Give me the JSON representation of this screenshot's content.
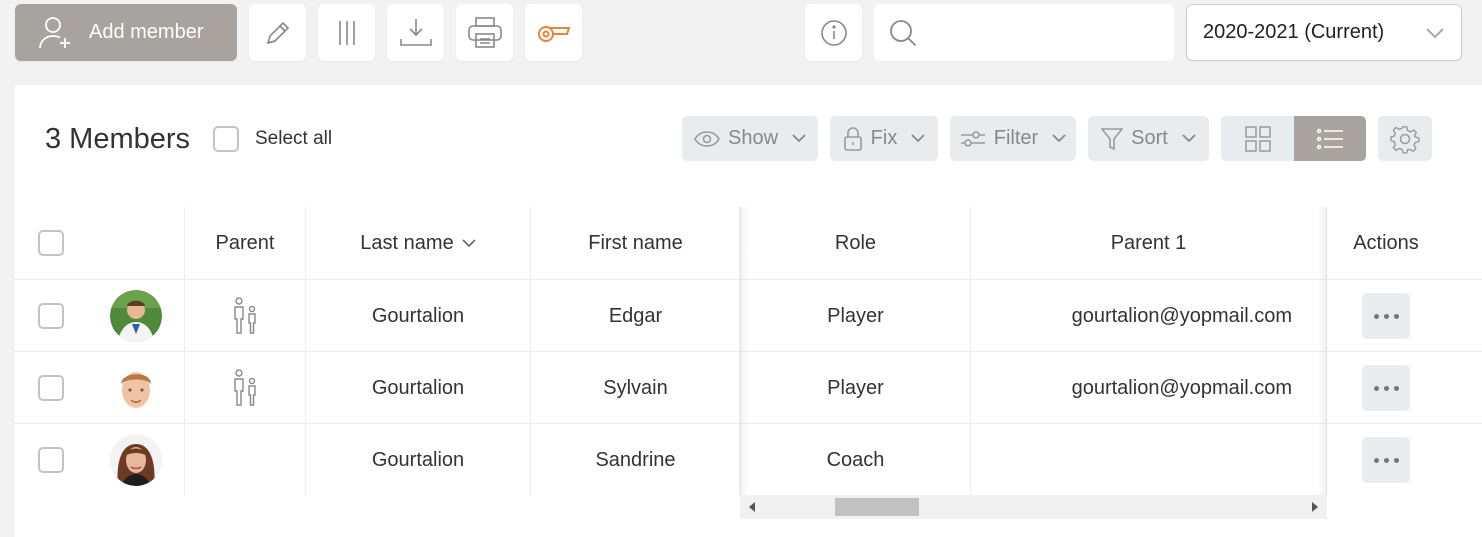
{
  "toolbar": {
    "add_member_label": "Add member",
    "search_placeholder": "",
    "season_selected": "2020-2021 (Current)"
  },
  "panel": {
    "count_label": "3 Members",
    "select_all_label": "Select all",
    "show_label": "Show",
    "fix_label": "Fix",
    "filter_label": "Filter",
    "sort_label": "Sort"
  },
  "table": {
    "headers": {
      "parent": "Parent",
      "last_name": "Last name",
      "first_name": "First name",
      "role": "Role",
      "parent1": "Parent 1",
      "actions": "Actions"
    },
    "rows": [
      {
        "last_name": "Gourtalion",
        "first_name": "Edgar",
        "role": "Player",
        "parent1": "gourtalion@yopmail.com",
        "has_parent": true
      },
      {
        "last_name": "Gourtalion",
        "first_name": "Sylvain",
        "role": "Player",
        "parent1": "gourtalion@yopmail.com",
        "has_parent": true
      },
      {
        "last_name": "Gourtalion",
        "first_name": "Sandrine",
        "role": "Coach",
        "parent1": "",
        "has_parent": false
      }
    ]
  },
  "colors": {
    "accent": "#a8a39e",
    "whistle": "#e8833a",
    "pill_bg": "#e9ecef"
  },
  "icons": [
    "add-user-icon",
    "pencil-icon",
    "columns-icon",
    "download-icon",
    "printer-icon",
    "whistle-icon",
    "info-icon",
    "search-icon",
    "chevron-down-icon",
    "eye-icon",
    "lock-icon",
    "sliders-icon",
    "funnel-icon",
    "grid-view-icon",
    "list-view-icon",
    "gear-icon",
    "family-icon",
    "more-icon"
  ]
}
